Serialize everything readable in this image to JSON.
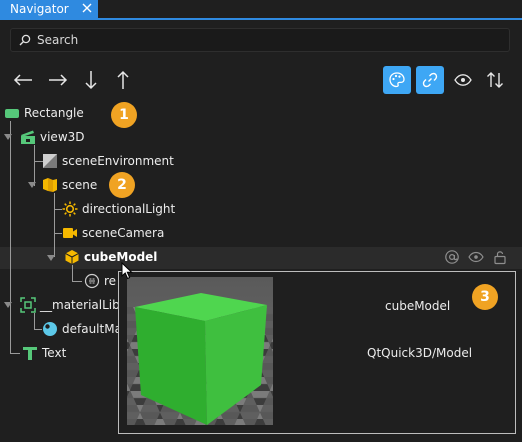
{
  "tab": {
    "label": "Navigator",
    "close_icon": "close-icon"
  },
  "search": {
    "placeholder": "Search",
    "value": ""
  },
  "toolbar": {
    "buttons": [
      {
        "icon": "arrow-left-icon"
      },
      {
        "icon": "arrow-right-icon"
      },
      {
        "icon": "arrow-down-icon"
      },
      {
        "icon": "arrow-up-icon"
      },
      {
        "icon": "palette-icon",
        "active": true
      },
      {
        "icon": "link-icon",
        "active": true
      },
      {
        "icon": "eye-icon",
        "active": false
      },
      {
        "icon": "sort-icon",
        "active": false
      }
    ],
    "active_color": "#3ea7f5"
  },
  "tree": {
    "items": [
      {
        "label": "Rectangle",
        "icon": "rectangle-icon"
      },
      {
        "label": "view3D",
        "icon": "view3d-icon"
      },
      {
        "label": "sceneEnvironment",
        "icon": "scene-environment-icon"
      },
      {
        "label": "scene",
        "icon": "scene-icon"
      },
      {
        "label": "directionalLight",
        "icon": "light-icon"
      },
      {
        "label": "sceneCamera",
        "icon": "camera-icon"
      },
      {
        "label": "cubeModel",
        "icon": "model-icon",
        "selected": true
      },
      {
        "label": "re",
        "icon": "reference-icon"
      },
      {
        "label": "__materialLibr",
        "icon": "material-library-icon"
      },
      {
        "label": "defaultMa",
        "icon": "material-icon"
      },
      {
        "label": "Text",
        "icon": "text-icon"
      }
    ]
  },
  "row_actions": [
    "alias-icon",
    "eye-icon",
    "lock-icon"
  ],
  "badges": [
    "1",
    "2",
    "3"
  ],
  "tooltip": {
    "id": "cubeModel",
    "type": "QtQuick3D/Model"
  },
  "colors": {
    "accent": "#2f8ae0",
    "badge": "#f0a323",
    "cube": "#3fbf3f"
  }
}
